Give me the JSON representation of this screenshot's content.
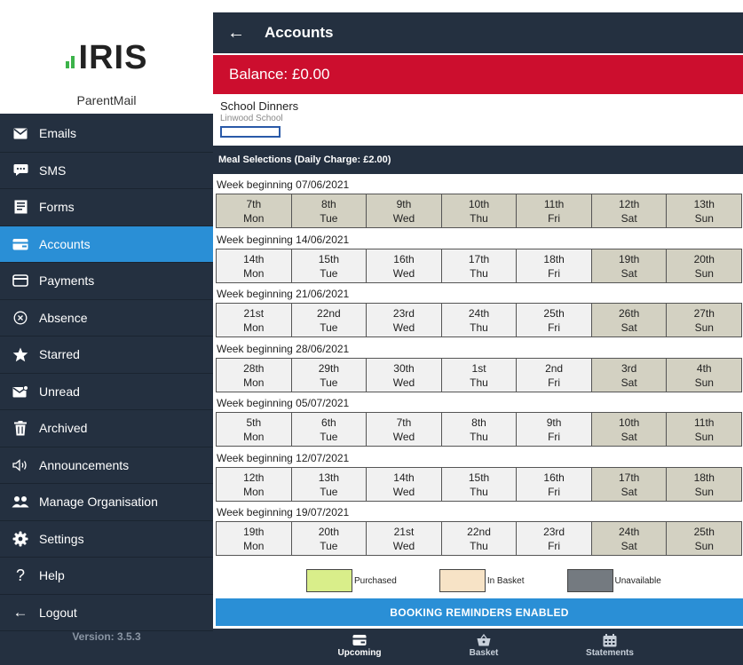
{
  "sidebar": {
    "logo_text": "IRIS",
    "brand_name": "ParentMail",
    "items": [
      {
        "label": "Emails",
        "icon": "envelope-icon"
      },
      {
        "label": "SMS",
        "icon": "chat-bubble-icon"
      },
      {
        "label": "Forms",
        "icon": "document-icon"
      },
      {
        "label": "Accounts",
        "icon": "wallet-icon",
        "active": true
      },
      {
        "label": "Payments",
        "icon": "card-icon"
      },
      {
        "label": "Absence",
        "icon": "circle-x-icon"
      },
      {
        "label": "Starred",
        "icon": "star-icon"
      },
      {
        "label": "Unread",
        "icon": "unread-envelope-icon"
      },
      {
        "label": "Archived",
        "icon": "trash-icon"
      },
      {
        "label": "Announcements",
        "icon": "speaker-icon"
      },
      {
        "label": "Manage Organisation",
        "icon": "people-icon"
      },
      {
        "label": "Settings",
        "icon": "gear-icon"
      },
      {
        "label": "Help",
        "icon": "question-icon"
      },
      {
        "label": "Logout",
        "icon": "arrow-left-icon"
      }
    ],
    "version": "Version: 3.5.3"
  },
  "header": {
    "title": "Accounts",
    "back_icon": "arrow-left-icon"
  },
  "balance": "Balance: £0.00",
  "service": {
    "name": "School Dinners",
    "school": "Linwood School"
  },
  "meal_header": "Meal Selections (Daily Charge: £2.00)",
  "weeks": [
    {
      "label": "Week beginning 07/06/2021",
      "days": [
        [
          "7th",
          "Mon"
        ],
        [
          "8th",
          "Tue"
        ],
        [
          "9th",
          "Wed"
        ],
        [
          "10th",
          "Thu"
        ],
        [
          "11th",
          "Fri"
        ],
        [
          "12th",
          "Sat"
        ],
        [
          "13th",
          "Sun"
        ]
      ]
    },
    {
      "label": "Week beginning 14/06/2021",
      "days": [
        [
          "14th",
          "Mon"
        ],
        [
          "15th",
          "Tue"
        ],
        [
          "16th",
          "Wed"
        ],
        [
          "17th",
          "Thu"
        ],
        [
          "18th",
          "Fri"
        ],
        [
          "19th",
          "Sat"
        ],
        [
          "20th",
          "Sun"
        ]
      ]
    },
    {
      "label": "Week beginning 21/06/2021",
      "days": [
        [
          "21st",
          "Mon"
        ],
        [
          "22nd",
          "Tue"
        ],
        [
          "23rd",
          "Wed"
        ],
        [
          "24th",
          "Thu"
        ],
        [
          "25th",
          "Fri"
        ],
        [
          "26th",
          "Sat"
        ],
        [
          "27th",
          "Sun"
        ]
      ]
    },
    {
      "label": "Week beginning 28/06/2021",
      "days": [
        [
          "28th",
          "Mon"
        ],
        [
          "29th",
          "Tue"
        ],
        [
          "30th",
          "Wed"
        ],
        [
          "1st",
          "Thu"
        ],
        [
          "2nd",
          "Fri"
        ],
        [
          "3rd",
          "Sat"
        ],
        [
          "4th",
          "Sun"
        ]
      ]
    },
    {
      "label": "Week beginning 05/07/2021",
      "days": [
        [
          "5th",
          "Mon"
        ],
        [
          "6th",
          "Tue"
        ],
        [
          "7th",
          "Wed"
        ],
        [
          "8th",
          "Thu"
        ],
        [
          "9th",
          "Fri"
        ],
        [
          "10th",
          "Sat"
        ],
        [
          "11th",
          "Sun"
        ]
      ]
    },
    {
      "label": "Week beginning 12/07/2021",
      "days": [
        [
          "12th",
          "Mon"
        ],
        [
          "13th",
          "Tue"
        ],
        [
          "14th",
          "Wed"
        ],
        [
          "15th",
          "Thu"
        ],
        [
          "16th",
          "Fri"
        ],
        [
          "17th",
          "Sat"
        ],
        [
          "18th",
          "Sun"
        ]
      ]
    },
    {
      "label": "Week beginning 19/07/2021",
      "days": [
        [
          "19th",
          "Mon"
        ],
        [
          "20th",
          "Tue"
        ],
        [
          "21st",
          "Wed"
        ],
        [
          "22nd",
          "Thu"
        ],
        [
          "23rd",
          "Fri"
        ],
        [
          "24th",
          "Sat"
        ],
        [
          "25th",
          "Sun"
        ]
      ]
    }
  ],
  "legend": [
    {
      "label": "Purchased",
      "color": "#d9ee8a"
    },
    {
      "label": "In Basket",
      "color": "#f7e3c6"
    },
    {
      "label": "Unavailable",
      "color": "#747a80"
    }
  ],
  "reminder_button": "BOOKING REMINDERS ENABLED",
  "bottom_nav": [
    {
      "label": "Upcoming",
      "icon": "wallet-icon",
      "active": true
    },
    {
      "label": "Basket",
      "icon": "basket-icon"
    },
    {
      "label": "Statements",
      "icon": "calendar-icon"
    }
  ],
  "colors": {
    "sidebar_bg": "#243040",
    "accent_blue": "#2a8fd6",
    "balance_red": "#cc0e2e",
    "unavailable_cell": "#d3d1c2",
    "logo_green": "#3cb34a"
  }
}
